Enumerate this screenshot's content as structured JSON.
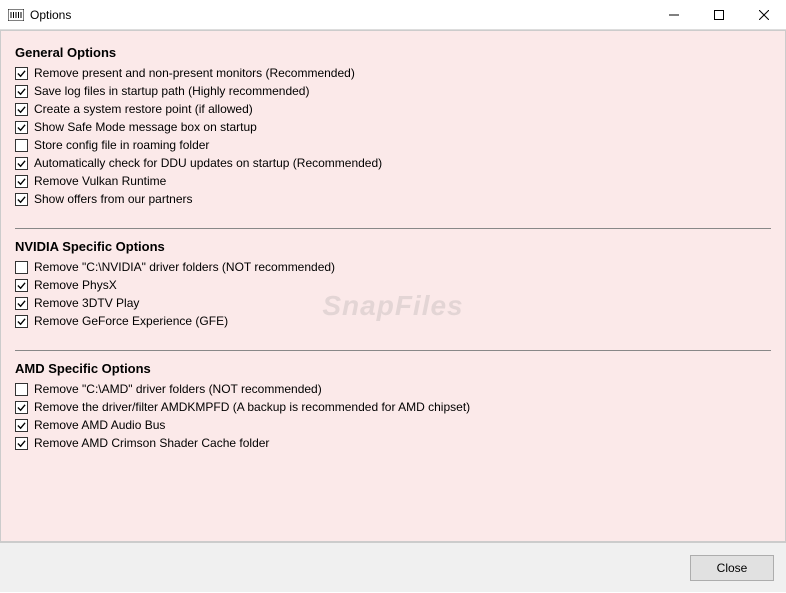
{
  "window": {
    "title": "Options"
  },
  "watermark": "SnapFiles",
  "sections": {
    "general": {
      "title": "General Options",
      "items": [
        {
          "label": "Remove present and non-present monitors (Recommended)",
          "checked": true
        },
        {
          "label": "Save log files in startup path (Highly recommended)",
          "checked": true
        },
        {
          "label": "Create a system restore point (if allowed)",
          "checked": true
        },
        {
          "label": "Show Safe Mode message box on startup",
          "checked": true
        },
        {
          "label": "Store config file in roaming folder",
          "checked": false
        },
        {
          "label": "Automatically check for DDU updates on startup (Recommended)",
          "checked": true
        },
        {
          "label": "Remove Vulkan Runtime",
          "checked": true
        },
        {
          "label": "Show offers from our partners",
          "checked": true
        }
      ]
    },
    "nvidia": {
      "title": "NVIDIA Specific Options",
      "items": [
        {
          "label": "Remove \"C:\\NVIDIA\" driver folders (NOT recommended)",
          "checked": false
        },
        {
          "label": "Remove PhysX",
          "checked": true
        },
        {
          "label": "Remove 3DTV Play",
          "checked": true
        },
        {
          "label": "Remove GeForce Experience (GFE)",
          "checked": true
        }
      ]
    },
    "amd": {
      "title": "AMD Specific Options",
      "items": [
        {
          "label": "Remove \"C:\\AMD\" driver folders (NOT recommended)",
          "checked": false
        },
        {
          "label": "Remove the driver/filter AMDKMPFD (A backup is recommended for AMD chipset)",
          "checked": true
        },
        {
          "label": "Remove AMD Audio Bus",
          "checked": true
        },
        {
          "label": "Remove AMD Crimson Shader Cache folder",
          "checked": true
        }
      ]
    }
  },
  "buttons": {
    "close": "Close"
  }
}
